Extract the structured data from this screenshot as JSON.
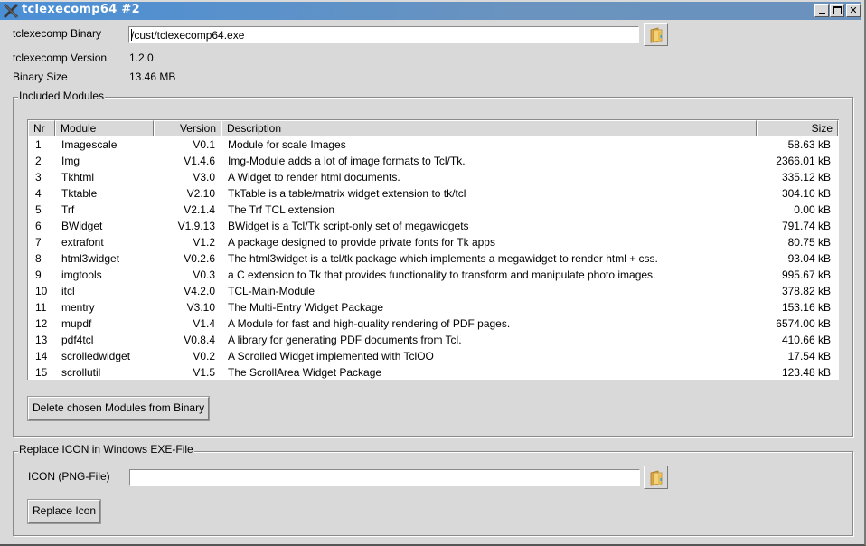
{
  "window": {
    "title": "tclexecomp64 #2",
    "controls": {
      "minimize": "minimize",
      "maximize": "maximize",
      "close": "✕"
    }
  },
  "binary": {
    "label": "tclexecomp Binary",
    "value": "/cust/tclexecomp64.exe",
    "browse_icon": "folder-icon"
  },
  "version": {
    "label": "tclexecomp Version",
    "value": "1.2.0"
  },
  "size": {
    "label": "Binary Size",
    "value": "13.46 MB"
  },
  "modules": {
    "group_title": "Included Modules",
    "columns": [
      "Nr",
      "Module",
      "Version",
      "Description",
      "Size"
    ],
    "rows": [
      {
        "nr": "1",
        "module": "Imagescale",
        "version": "V0.1",
        "description": "Module for scale Images",
        "size": "58.63 kB"
      },
      {
        "nr": "2",
        "module": "Img",
        "version": "V1.4.6",
        "description": "Img-Module adds a lot of image formats to Tcl/Tk.",
        "size": "2366.01 kB"
      },
      {
        "nr": "3",
        "module": "Tkhtml",
        "version": "V3.0",
        "description": "A Widget to render html documents.",
        "size": "335.12 kB"
      },
      {
        "nr": "4",
        "module": "Tktable",
        "version": "V2.10",
        "description": "TkTable is a table/matrix widget extension to tk/tcl",
        "size": "304.10 kB"
      },
      {
        "nr": "5",
        "module": "Trf",
        "version": "V2.1.4",
        "description": "The Trf TCL extension",
        "size": "0.00 kB"
      },
      {
        "nr": "6",
        "module": "BWidget",
        "version": "V1.9.13",
        "description": "BWidget is a Tcl/Tk script-only set of megawidgets",
        "size": "791.74 kB"
      },
      {
        "nr": "7",
        "module": "extrafont",
        "version": "V1.2",
        "description": "A package designed to provide private fonts for Tk apps",
        "size": "80.75 kB"
      },
      {
        "nr": "8",
        "module": "html3widget",
        "version": "V0.2.6",
        "description": "The html3widget is a tcl/tk package which implements a megawidget to render html + css.",
        "size": "93.04 kB"
      },
      {
        "nr": "9",
        "module": "imgtools",
        "version": "V0.3",
        "description": "a C extension to Tk that provides functionality to transform and manipulate photo images.",
        "size": "995.67 kB"
      },
      {
        "nr": "10",
        "module": "itcl",
        "version": "V4.2.0",
        "description": "TCL-Main-Module",
        "size": "378.82 kB"
      },
      {
        "nr": "11",
        "module": "mentry",
        "version": "V3.10",
        "description": "The Multi-Entry Widget Package",
        "size": "153.16 kB"
      },
      {
        "nr": "12",
        "module": "mupdf",
        "version": "V1.4",
        "description": "A Module for fast and high-quality rendering of PDF pages.",
        "size": "6574.00 kB"
      },
      {
        "nr": "13",
        "module": "pdf4tcl",
        "version": "V0.8.4",
        "description": "A library for generating PDF documents from Tcl.",
        "size": "410.66 kB"
      },
      {
        "nr": "14",
        "module": "scrolledwidget",
        "version": "V0.2",
        "description": "A Scrolled Widget implemented with TclOO",
        "size": "17.54 kB"
      },
      {
        "nr": "15",
        "module": "scrollutil",
        "version": "V1.5",
        "description": "The ScrollArea Widget Package",
        "size": "123.48 kB"
      }
    ],
    "delete_button": "Delete chosen Modules from Binary"
  },
  "icon": {
    "group_title": "Replace ICON in Windows EXE-File",
    "label": "ICON (PNG-File)",
    "value": "",
    "browse_icon": "folder-icon",
    "replace_button": "Replace Icon"
  }
}
